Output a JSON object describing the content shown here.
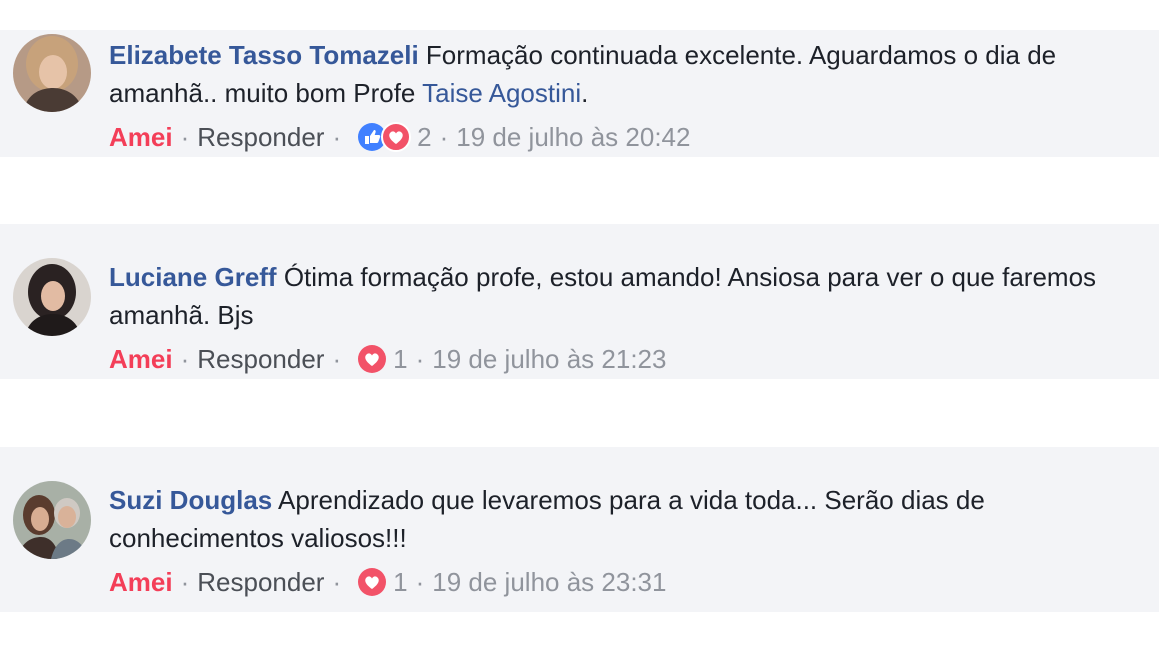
{
  "comments": [
    {
      "author": "Elizabete Tasso Tomazeli",
      "text_before": " Formação continuada excelente. Aguardamos o dia de amanhã.. muito bom Profe ",
      "mention": "Taise Agostini",
      "text_after": ".",
      "reaction_label": "Amei",
      "reply_label": "Responder",
      "reactions": [
        "like-icon",
        "love-icon"
      ],
      "reaction_count": "2",
      "timestamp": "19 de julho às 20:42"
    },
    {
      "author": "Luciane Greff",
      "text": " Ótima formação profe, estou amando! Ansiosa para ver o que faremos amanhã. Bjs",
      "reaction_label": "Amei",
      "reply_label": "Responder",
      "reactions": [
        "love-icon"
      ],
      "reaction_count": "1",
      "timestamp": "19 de julho às 21:23"
    },
    {
      "author": "Suzi Douglas",
      "text": " Aprendizado que levaremos para a vida toda... Serão dias de conhecimentos valiosos!!!",
      "reaction_label": "Amei",
      "reply_label": "Responder",
      "reactions": [
        "love-icon"
      ],
      "reaction_count": "1",
      "timestamp": "19 de julho às 23:31"
    }
  ],
  "separator": "·",
  "colors": {
    "author": "#365899",
    "amei": "#f33e58",
    "meta": "#90949c",
    "like": "#4080ff",
    "love": "#f25268",
    "background": "#f3f4f7"
  }
}
